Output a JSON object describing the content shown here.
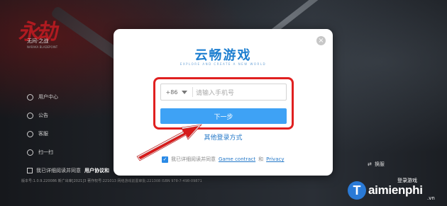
{
  "game": {
    "logo_mark": "永劫",
    "logo_sub": "无间·之战",
    "logo_tiny": "NARAKA BLADEPOINT"
  },
  "sidebar": {
    "items": [
      {
        "label": "用户中心",
        "icon": "user-icon"
      },
      {
        "label": "公告",
        "icon": "notice-icon"
      },
      {
        "label": "客服",
        "icon": "support-icon"
      },
      {
        "label": "扫一扫",
        "icon": "scan-icon"
      }
    ]
  },
  "bg_agree": {
    "text": "我已详细阅读并同意",
    "link": "用户协议和"
  },
  "footer": {
    "left": "版本号:1.0.9.220086  新广出审[2021]3  著作权号:221013  网络游戏前置审批:221308  ISBN 978-7-498-09871",
    "right": "ISBN 978-7-498-09871"
  },
  "switch_label": "换服",
  "login_bar": "登录游戏",
  "modal": {
    "brand": "云畅游戏",
    "brand_sub": "EXPLORE AND CREATE A NEW WORLD",
    "close": "×",
    "country_code": "+86",
    "phone_placeholder": "请输入手机号",
    "next_label": "下一步",
    "other_login": "其他登录方式",
    "terms_prefix": "我已详细阅读并同意",
    "game_contract": "Game contract",
    "and": "和",
    "privacy": "Privacy"
  },
  "watermark": {
    "letter": "T",
    "text": "aimienphi",
    "suffix": ".vn"
  },
  "colors": {
    "accent": "#3ea2f5",
    "brand": "#1e7fd0",
    "highlight": "#e02020"
  }
}
